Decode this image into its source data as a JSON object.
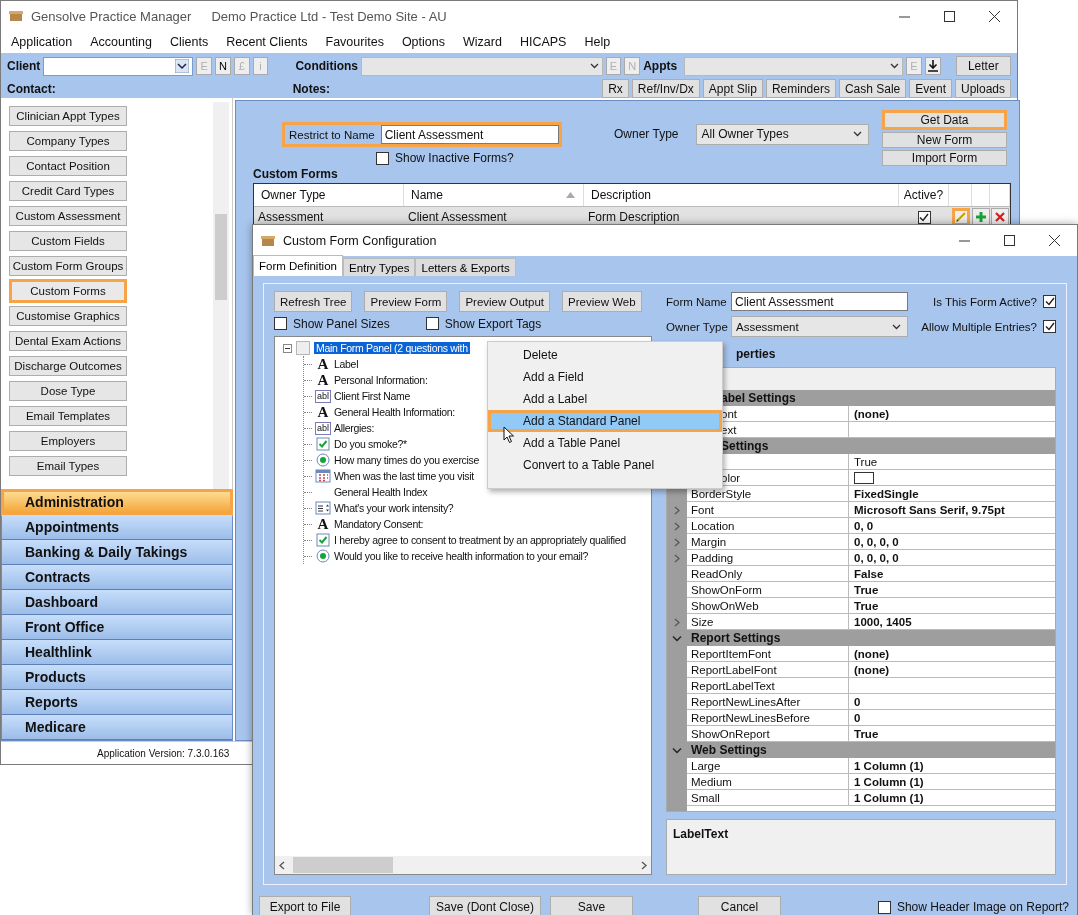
{
  "main_window": {
    "title": "Gensolve Practice Manager",
    "subtitle": "Demo Practice Ltd - Test Demo Site - AU"
  },
  "menu": [
    "Application",
    "Accounting",
    "Clients",
    "Recent Clients",
    "Favourites",
    "Options",
    "Wizard",
    "HICAPS",
    "Help"
  ],
  "toolbar": {
    "client_label": "Client",
    "client_buttons": [
      {
        "label": "E",
        "disabled": true
      },
      {
        "label": "N",
        "disabled": false
      },
      {
        "label": "£",
        "disabled": true
      },
      {
        "label": "i",
        "disabled": true
      }
    ],
    "conditions_label": "Conditions",
    "conditions_buttons": [
      {
        "label": "E",
        "disabled": true
      },
      {
        "label": "N",
        "disabled": true
      }
    ],
    "appts_label": "Appts",
    "appts_buttons": [
      {
        "label": "E",
        "disabled": true
      }
    ],
    "letter": "Letter",
    "contact_label": "Contact:",
    "notes_label": "Notes:",
    "actions": [
      "Rx",
      "Ref/Inv/Dx",
      "Appt Slip",
      "Reminders",
      "Cash Sale",
      "Event",
      "Uploads"
    ]
  },
  "admin_list": [
    {
      "label": "Clinician Appt Types",
      "selected": false
    },
    {
      "label": "Company Types",
      "selected": false
    },
    {
      "label": "Contact Position",
      "selected": false
    },
    {
      "label": "Credit Card Types",
      "selected": false
    },
    {
      "label": "Custom Assessment",
      "selected": false
    },
    {
      "label": "Custom Fields",
      "selected": false
    },
    {
      "label": "Custom Form Groups",
      "selected": false
    },
    {
      "label": "Custom Forms",
      "selected": true
    },
    {
      "label": "Customise Graphics",
      "selected": false
    },
    {
      "label": "Dental Exam Actions",
      "selected": false
    },
    {
      "label": "Discharge Outcomes",
      "selected": false
    },
    {
      "label": "Dose Type",
      "selected": false
    },
    {
      "label": "Email Templates",
      "selected": false
    },
    {
      "label": "Employers",
      "selected": false
    },
    {
      "label": "Email Types",
      "selected": false
    }
  ],
  "nav": [
    {
      "label": "Administration",
      "selected": true
    },
    {
      "label": "Appointments",
      "selected": false
    },
    {
      "label": "Banking & Daily Takings",
      "selected": false
    },
    {
      "label": "Contracts",
      "selected": false
    },
    {
      "label": "Dashboard",
      "selected": false
    },
    {
      "label": "Front Office",
      "selected": false
    },
    {
      "label": "Healthlink",
      "selected": false
    },
    {
      "label": "Products",
      "selected": false
    },
    {
      "label": "Reports",
      "selected": false
    },
    {
      "label": "Medicare",
      "selected": false
    }
  ],
  "status_bar": "Application Version: 7.3.0.163",
  "filter": {
    "name_label": "Restrict to Name",
    "name_value": "Client Assessment",
    "owner_label": "Owner Type",
    "owner_value": "All Owner Types",
    "inactive_label": "Show Inactive Forms?",
    "inactive_checked": false
  },
  "form_buttons": [
    {
      "label": "Get Data",
      "highlighted": true
    },
    {
      "label": "New Form",
      "highlighted": false
    },
    {
      "label": "Import Form",
      "highlighted": false
    }
  ],
  "custom_forms": {
    "title": "Custom Forms",
    "columns": [
      {
        "label": "Owner Type",
        "sorted": false
      },
      {
        "label": "Name",
        "sorted": true
      },
      {
        "label": "Description",
        "sorted": false
      },
      {
        "label": "Active?",
        "sorted": false
      }
    ],
    "rows": [
      {
        "owner_type": "Assessment",
        "name": "Client Assessment",
        "description": "Form Description",
        "active": true,
        "edit_highlighted": true
      }
    ]
  },
  "dialog": {
    "title": "Custom Form Configuration",
    "tabs": [
      {
        "label": "Form Definition",
        "selected": true
      },
      {
        "label": "Entry Types",
        "selected": false
      },
      {
        "label": "Letters & Exports",
        "selected": false
      }
    ],
    "tree_buttons": [
      "Refresh Tree",
      "Preview Form",
      "Preview Output",
      "Preview Web"
    ],
    "options": [
      {
        "label": "Show Panel Sizes",
        "checked": false
      },
      {
        "label": "Show Export Tags",
        "checked": false
      }
    ],
    "tree": {
      "label": "Main Form Panel (2 questions with",
      "selected": true,
      "expanded": true,
      "children": [
        {
          "label": "Label",
          "kind": "label",
          "icon": "A"
        },
        {
          "label": "Personal Information:",
          "kind": "label",
          "icon": "A"
        },
        {
          "label": "Client First Name",
          "kind": "text",
          "icon": "abl"
        },
        {
          "label": "General Health Information:",
          "kind": "label",
          "icon": "A"
        },
        {
          "label": "Allergies:",
          "kind": "text",
          "icon": "abl"
        },
        {
          "label": "Do you smoke?*",
          "kind": "checkbox"
        },
        {
          "label": "How many times do you exercise",
          "kind": "radio"
        },
        {
          "label": "When was the last time you visit",
          "kind": "date"
        },
        {
          "label": "General Health Index",
          "kind": "none"
        },
        {
          "label": "What's your work intensity?",
          "kind": "numeric"
        },
        {
          "label": "Mandatory Consent:",
          "kind": "label",
          "icon": "A"
        },
        {
          "label": "I hereby agree to consent to treatment by an appropriately qualified",
          "kind": "checkbox"
        },
        {
          "label": "Would you like to receive health information to your email?",
          "kind": "radio"
        }
      ]
    },
    "form_name_label": "Form Name",
    "form_name": "Client Assessment",
    "owner_type_label": "Owner Type",
    "owner_type": "Assessment",
    "active_label": "Is This Form Active?",
    "active": true,
    "multiple_label": "Allow Multiple Entries?",
    "multiple": true,
    "properties_title": "perties",
    "properties": [
      {
        "kind": "section",
        "name": "abel Settings",
        "partial": true
      },
      {
        "kind": "prop",
        "name": "ont",
        "value": "(none)",
        "bold": true,
        "expandable": false,
        "partial": true
      },
      {
        "kind": "prop",
        "name": "ext",
        "expandable": false,
        "partial": true
      },
      {
        "kind": "section",
        "name": "Settings",
        "partial": true
      },
      {
        "kind": "prop",
        "value": "True",
        "bold": false
      },
      {
        "kind": "swatch",
        "name": "olor",
        "partial": true
      },
      {
        "kind": "prop",
        "name": "BorderStyle",
        "value": "FixedSingle",
        "bold": true,
        "expandable": false,
        "partial": false
      },
      {
        "kind": "prop",
        "name": "Font",
        "value": "Microsoft Sans Serif, 9.75pt",
        "bold": true,
        "expandable": true,
        "partial": false
      },
      {
        "kind": "prop",
        "name": "Location",
        "value": "0, 0",
        "bold": true,
        "expandable": true,
        "partial": false
      },
      {
        "kind": "prop",
        "name": "Margin",
        "value": "0, 0, 0, 0",
        "bold": true,
        "expandable": true,
        "partial": false
      },
      {
        "kind": "prop",
        "name": "Padding",
        "value": "0, 0, 0, 0",
        "bold": true,
        "expandable": true,
        "partial": false
      },
      {
        "kind": "prop",
        "name": "ReadOnly",
        "value": "False",
        "bold": true,
        "expandable": false,
        "partial": false
      },
      {
        "kind": "prop",
        "name": "ShowOnForm",
        "value": "True",
        "bold": true,
        "expandable": false,
        "partial": false
      },
      {
        "kind": "prop",
        "name": "ShowOnWeb",
        "value": "True",
        "bold": true,
        "expandable": false,
        "partial": false
      },
      {
        "kind": "prop",
        "name": "Size",
        "value": "1000, 1405",
        "bold": true,
        "expandable": true,
        "partial": false
      },
      {
        "kind": "section",
        "name": "Report Settings",
        "partial": false
      },
      {
        "kind": "prop",
        "name": "ReportItemFont",
        "value": "(none)",
        "bold": true,
        "expandable": false,
        "partial": false
      },
      {
        "kind": "prop",
        "name": "ReportLabelFont",
        "value": "(none)",
        "bold": true,
        "expandable": false,
        "partial": false
      },
      {
        "kind": "prop",
        "name": "ReportLabelText",
        "expandable": false,
        "partial": false
      },
      {
        "kind": "prop",
        "name": "ReportNewLinesAfter",
        "value": "0",
        "bold": true,
        "expandable": false,
        "partial": false
      },
      {
        "kind": "prop",
        "name": "ReportNewLinesBefore",
        "value": "0",
        "bold": true,
        "expandable": false,
        "partial": false
      },
      {
        "kind": "prop",
        "name": "ShowOnReport",
        "value": "True",
        "bold": true,
        "expandable": false,
        "partial": false
      },
      {
        "kind": "section",
        "name": "Web Settings",
        "partial": false
      },
      {
        "kind": "prop",
        "name": "Large",
        "value": "1 Column (1)",
        "bold": true,
        "expandable": false,
        "partial": false
      },
      {
        "kind": "prop",
        "name": "Medium",
        "value": "1 Column (1)",
        "bold": true,
        "expandable": false,
        "partial": false
      },
      {
        "kind": "prop",
        "name": "Small",
        "value": "1 Column (1)",
        "bold": true,
        "expandable": false,
        "partial": false
      }
    ],
    "description_title": "LabelText",
    "footer": [
      "Export to File",
      "Save (Dont Close)",
      "Save",
      "Cancel"
    ],
    "header_image_label": "Show Header Image on Report?",
    "header_image_checked": false
  },
  "context_menu": [
    {
      "label": "Delete",
      "selected": false
    },
    {
      "label": "Add a Field",
      "selected": false
    },
    {
      "label": "Add a Label",
      "selected": false
    },
    {
      "label": "Add a Standard Panel",
      "selected": true
    },
    {
      "label": "Add a Table Panel",
      "selected": false
    },
    {
      "label": "Convert to a Table Panel",
      "selected": false
    }
  ]
}
